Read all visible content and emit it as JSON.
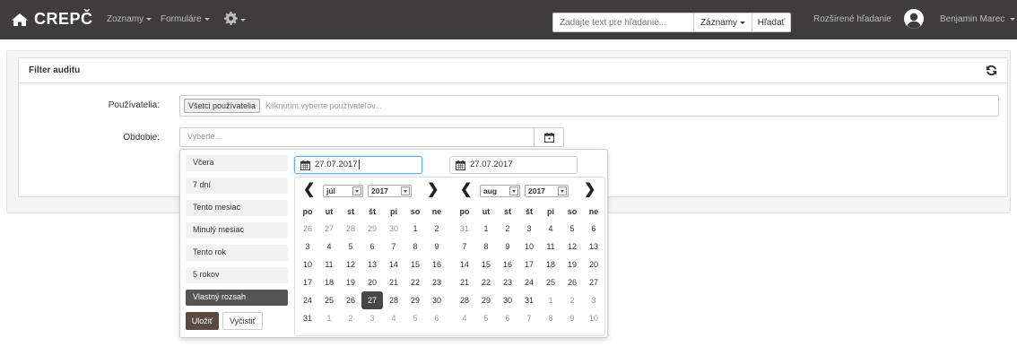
{
  "navbar": {
    "brand": "CREPČ",
    "menus": [
      "Zoznamy",
      "Formuláre"
    ],
    "settings_icon": "gear-icon",
    "search_placeholder": "Zadajte text pre hľadanie...",
    "search_scope": "Záznamy",
    "search_button": "Hľadať",
    "advanced_search": "Rozšírené hľadanie",
    "user_name": "Benjamin Marec"
  },
  "panel": {
    "title": "Filter auditu",
    "refresh_icon": "refresh-icon",
    "users_label": "Používatelia:",
    "users_tag": "Všetci používatelia",
    "users_placeholder": "Kliknutím vyberte používateľov...",
    "period_label": "Obdobie:",
    "period_placeholder": "Vyberte..."
  },
  "picker": {
    "ranges": [
      "Včera",
      "7 dní",
      "Tento mesiac",
      "Minulý mesiac",
      "Tento rok",
      "5 rokov",
      "Vlastný rozsah"
    ],
    "active_range": "Vlastný rozsah",
    "save": "Uložiť",
    "clear": "Vyčistiť",
    "weekdays": [
      "po",
      "ut",
      "st",
      "št",
      "pi",
      "so",
      "ne"
    ],
    "left": {
      "date": "27.07.2017",
      "month": "júl",
      "year": "2017",
      "weeks": [
        [
          [
            "26",
            1
          ],
          [
            "27",
            1
          ],
          [
            "28",
            1
          ],
          [
            "29",
            1
          ],
          [
            "30",
            1
          ],
          [
            "1",
            0
          ],
          [
            "2",
            0
          ]
        ],
        [
          [
            "3",
            0
          ],
          [
            "4",
            0
          ],
          [
            "5",
            0
          ],
          [
            "6",
            0
          ],
          [
            "7",
            0
          ],
          [
            "8",
            0
          ],
          [
            "9",
            0
          ]
        ],
        [
          [
            "10",
            0
          ],
          [
            "11",
            0
          ],
          [
            "12",
            0
          ],
          [
            "13",
            0
          ],
          [
            "14",
            0
          ],
          [
            "15",
            0
          ],
          [
            "16",
            0
          ]
        ],
        [
          [
            "17",
            0
          ],
          [
            "18",
            0
          ],
          [
            "19",
            0
          ],
          [
            "20",
            0
          ],
          [
            "21",
            0
          ],
          [
            "22",
            0
          ],
          [
            "23",
            0
          ]
        ],
        [
          [
            "24",
            0
          ],
          [
            "25",
            0
          ],
          [
            "26",
            0
          ],
          [
            "27",
            2
          ],
          [
            "28",
            0
          ],
          [
            "29",
            0
          ],
          [
            "30",
            0
          ]
        ],
        [
          [
            "31",
            0
          ],
          [
            "1",
            1
          ],
          [
            "2",
            1
          ],
          [
            "3",
            1
          ],
          [
            "4",
            1
          ],
          [
            "5",
            1
          ],
          [
            "6",
            1
          ]
        ]
      ]
    },
    "right": {
      "date": "27.07.2017",
      "month": "aug",
      "year": "2017",
      "weeks": [
        [
          [
            "31",
            1
          ],
          [
            "1",
            0
          ],
          [
            "2",
            0
          ],
          [
            "3",
            0
          ],
          [
            "4",
            0
          ],
          [
            "5",
            0
          ],
          [
            "6",
            0
          ]
        ],
        [
          [
            "7",
            0
          ],
          [
            "8",
            0
          ],
          [
            "9",
            0
          ],
          [
            "10",
            0
          ],
          [
            "11",
            0
          ],
          [
            "12",
            0
          ],
          [
            "13",
            0
          ]
        ],
        [
          [
            "14",
            0
          ],
          [
            "15",
            0
          ],
          [
            "16",
            0
          ],
          [
            "17",
            0
          ],
          [
            "18",
            0
          ],
          [
            "19",
            0
          ],
          [
            "20",
            0
          ]
        ],
        [
          [
            "21",
            0
          ],
          [
            "22",
            0
          ],
          [
            "23",
            0
          ],
          [
            "24",
            0
          ],
          [
            "25",
            0
          ],
          [
            "26",
            0
          ],
          [
            "27",
            0
          ]
        ],
        [
          [
            "28",
            0
          ],
          [
            "29",
            0
          ],
          [
            "30",
            0
          ],
          [
            "31",
            0
          ],
          [
            "1",
            1
          ],
          [
            "2",
            1
          ],
          [
            "3",
            1
          ]
        ],
        [
          [
            "4",
            1
          ],
          [
            "5",
            1
          ],
          [
            "6",
            1
          ],
          [
            "7",
            1
          ],
          [
            "8",
            1
          ],
          [
            "9",
            1
          ],
          [
            "10",
            1
          ]
        ]
      ]
    }
  }
}
